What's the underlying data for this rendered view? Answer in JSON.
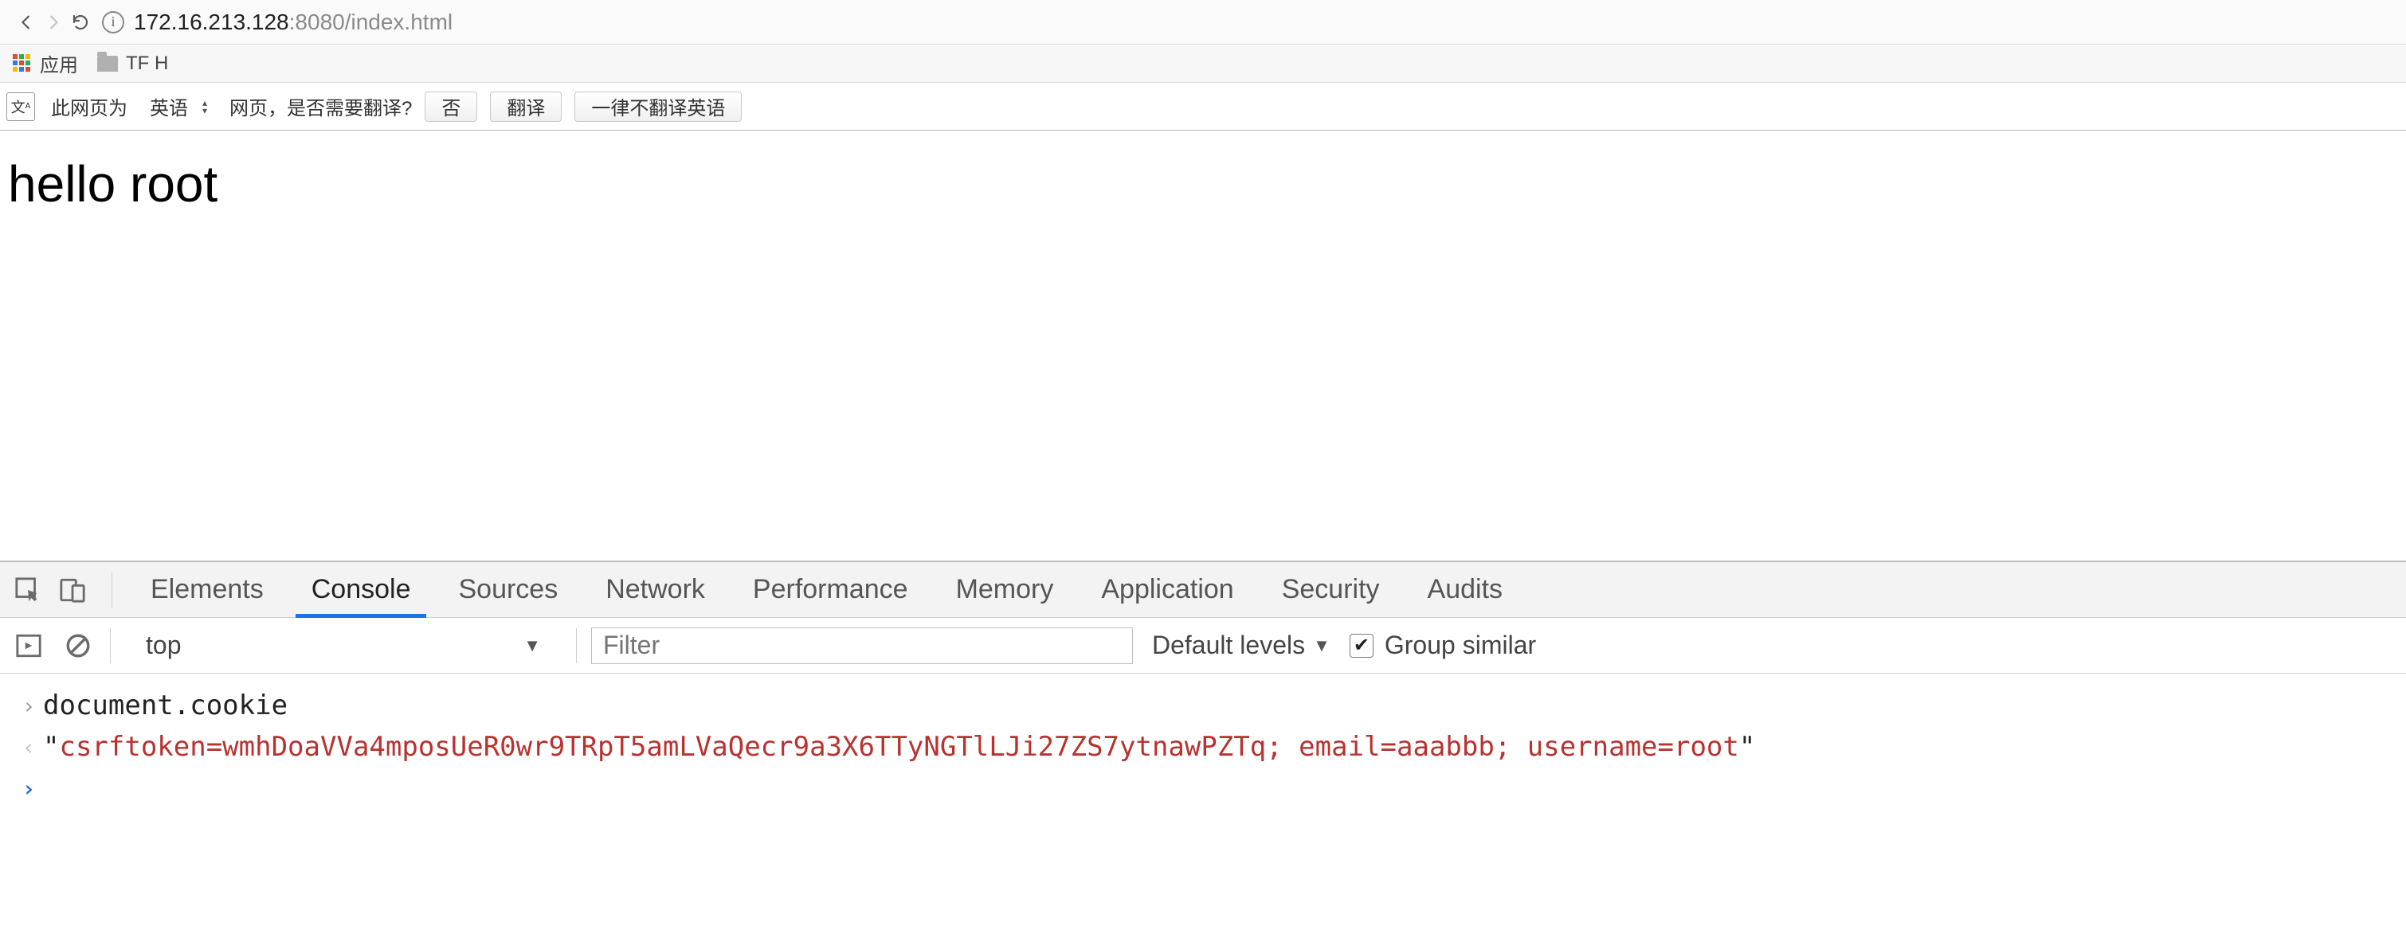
{
  "browser": {
    "url_host": "172.16.213.128",
    "url_port": ":8080",
    "url_path": "/index.html"
  },
  "bookmarks": {
    "apps_label": "应用",
    "folder_label": "TF H"
  },
  "translate": {
    "prefix": "此网页为",
    "language": "英语",
    "question": "网页，是否需要翻译?",
    "btn_no": "否",
    "btn_translate": "翻译",
    "btn_never": "一律不翻译英语"
  },
  "page": {
    "heading": "hello root"
  },
  "devtools": {
    "tabs": {
      "elements": "Elements",
      "console": "Console",
      "sources": "Sources",
      "network": "Network",
      "performance": "Performance",
      "memory": "Memory",
      "application": "Application",
      "security": "Security",
      "audits": "Audits"
    },
    "toolbar": {
      "context": "top",
      "filter_placeholder": "Filter",
      "levels_label": "Default levels",
      "group_label": "Group similar"
    },
    "console": {
      "input_expr": "document.cookie",
      "output_value": "csrftoken=wmhDoaVVa4mposUeR0wr9TRpT5amLVaQecr9a3X6TTyNGTlLJi27ZS7ytnawPZTq; email=aaabbb; username=root"
    }
  }
}
